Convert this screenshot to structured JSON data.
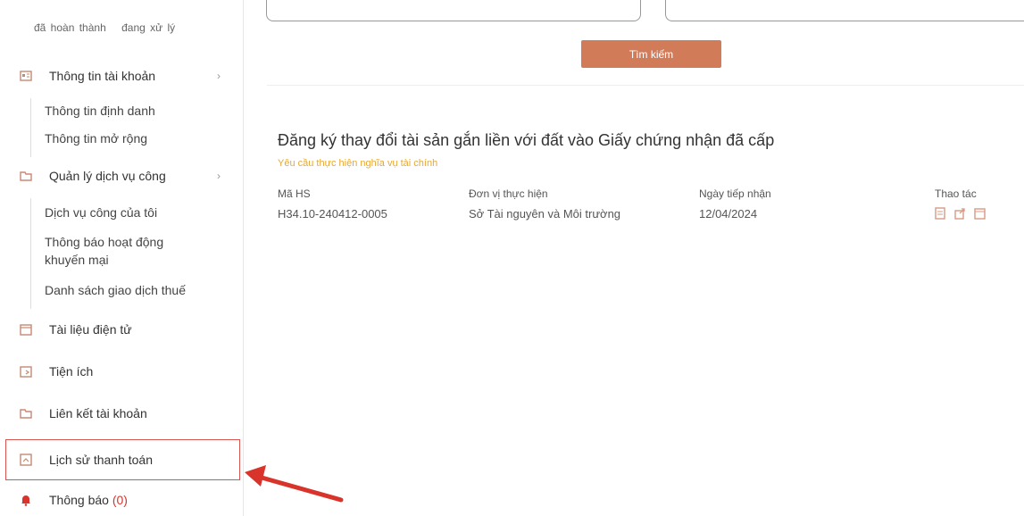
{
  "sidebar": {
    "top_status": [
      "đã hoàn thành",
      "đang xử lý"
    ],
    "account_info": {
      "label": "Thông tin tài khoản",
      "chevron": "›",
      "icon": "id-card-icon"
    },
    "account_sub": [
      "Thông tin định danh",
      "Thông tin mở rộng"
    ],
    "public_services": {
      "label": "Quản lý dịch vụ công",
      "chevron": "›",
      "icon": "folder-icon"
    },
    "public_services_sub": [
      "Dịch vụ công của tôi",
      "Thông báo hoạt động",
      "khuyến mại",
      "Danh sách giao dịch thuế"
    ],
    "items": [
      {
        "label": "Tài liệu điện tử",
        "icon": "document-icon"
      },
      {
        "label": "Tiện ích",
        "icon": "utility-icon"
      },
      {
        "label": "Liên kết tài khoản",
        "icon": "link-icon"
      },
      {
        "label": "Lịch sử thanh toán",
        "icon": "payment-history-icon"
      }
    ],
    "notifications": {
      "label": "Thông báo",
      "count": "(0)",
      "icon": "bell-icon"
    }
  },
  "main": {
    "search_button": "Tìm kiếm",
    "record": {
      "title": "Đăng ký thay đổi tài sản gắn liền với đất vào Giấy chứng nhận đã cấp",
      "subtitle": "Yêu cầu thực hiện nghĩa vụ tài chính",
      "columns": [
        "Mã HS",
        "Đơn vị thực hiện",
        "Ngày tiếp nhận",
        "Thao tác"
      ],
      "values": {
        "code": "H34.10-240412-0005",
        "unit": "Sở Tài nguyên và Môi trường",
        "date": "12/04/2024"
      },
      "actions": [
        "view-icon",
        "share-icon",
        "copy-icon"
      ]
    }
  },
  "colors": {
    "accent": "#d27b59",
    "highlight_border": "#d9534f",
    "subtitle": "#e7a832",
    "arrow": "#d9342b"
  }
}
